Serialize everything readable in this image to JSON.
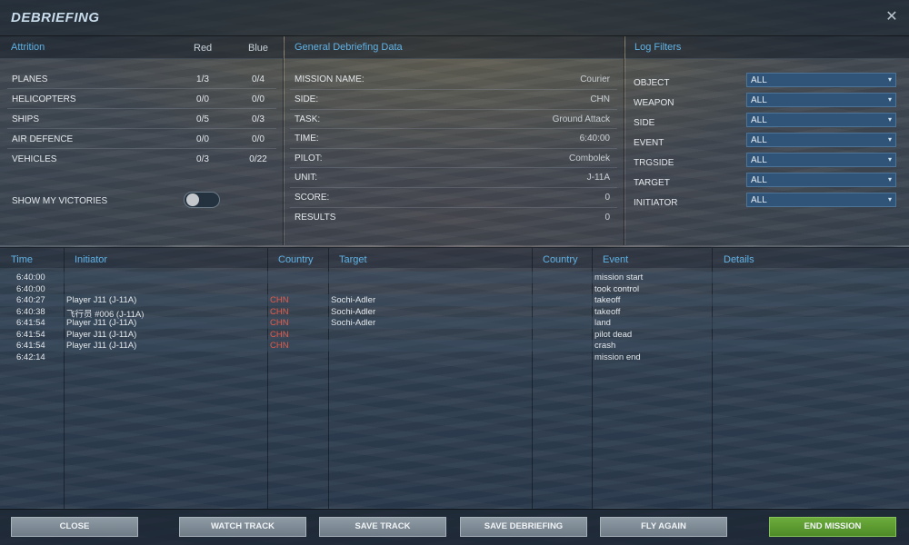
{
  "window": {
    "title": "DEBRIEFING"
  },
  "attrition": {
    "header": "Attrition",
    "col_red": "Red",
    "col_blue": "Blue",
    "rows": [
      {
        "label": "PLANES",
        "red": "1/3",
        "blue": "0/4"
      },
      {
        "label": "HELICOPTERS",
        "red": "0/0",
        "blue": "0/0"
      },
      {
        "label": "SHIPS",
        "red": "0/5",
        "blue": "0/3"
      },
      {
        "label": "AIR DEFENCE",
        "red": "0/0",
        "blue": "0/0"
      },
      {
        "label": "VEHICLES",
        "red": "0/3",
        "blue": "0/22"
      }
    ],
    "show_victories_label": "SHOW MY VICTORIES",
    "show_victories_on": false
  },
  "general": {
    "header": "General Debriefing Data",
    "rows": [
      {
        "label": "MISSION NAME:",
        "value": "Courier"
      },
      {
        "label": "SIDE:",
        "value": "CHN"
      },
      {
        "label": "TASK:",
        "value": "Ground Attack"
      },
      {
        "label": "TIME:",
        "value": "6:40:00"
      },
      {
        "label": "PILOT:",
        "value": "Combolek"
      },
      {
        "label": "UNIT:",
        "value": "J-11A"
      },
      {
        "label": "SCORE:",
        "value": "0"
      },
      {
        "label": "RESULTS",
        "value": "0"
      }
    ]
  },
  "log_filters": {
    "header": "Log Filters",
    "filters": [
      {
        "label": "OBJECT",
        "value": "ALL"
      },
      {
        "label": "WEAPON",
        "value": "ALL"
      },
      {
        "label": "SIDE",
        "value": "ALL"
      },
      {
        "label": "EVENT",
        "value": "ALL"
      },
      {
        "label": "TRGSIDE",
        "value": "ALL"
      },
      {
        "label": "TARGET",
        "value": "ALL"
      },
      {
        "label": "INITIATOR",
        "value": "ALL"
      }
    ]
  },
  "log": {
    "columns": {
      "time": "Time",
      "initiator": "Initiator",
      "country": "Country",
      "target": "Target",
      "target_country": "Country",
      "event": "Event",
      "details": "Details"
    },
    "rows": [
      {
        "time": "6:40:00",
        "initiator": "",
        "country": "",
        "target": "",
        "event": "mission start"
      },
      {
        "time": "6:40:00",
        "initiator": "",
        "country": "",
        "target": "",
        "event": "took control"
      },
      {
        "time": "6:40:27",
        "initiator": "Player J11 (J-11A)",
        "country": "CHN",
        "target": "Sochi-Adler",
        "event": "takeoff"
      },
      {
        "time": "6:40:38",
        "initiator": "飞行员 #006 (J-11A)",
        "country": "CHN",
        "target": "Sochi-Adler",
        "event": "takeoff"
      },
      {
        "time": "6:41:54",
        "initiator": "Player J11 (J-11A)",
        "country": "CHN",
        "target": "Sochi-Adler",
        "event": "land"
      },
      {
        "time": "6:41:54",
        "initiator": "Player J11 (J-11A)",
        "country": "CHN",
        "target": "",
        "event": "pilot dead"
      },
      {
        "time": "6:41:54",
        "initiator": "Player J11 (J-11A)",
        "country": "CHN",
        "target": "",
        "event": "crash"
      },
      {
        "time": "6:42:14",
        "initiator": "",
        "country": "",
        "target": "",
        "event": "mission end"
      }
    ]
  },
  "footer": {
    "close": "CLOSE",
    "watch_track": "WATCH TRACK",
    "save_track": "SAVE TRACK",
    "save_debriefing": "SAVE DEBRIEFING",
    "fly_again": "FLY AGAIN",
    "end_mission": "END MISSION"
  },
  "colors": {
    "accent": "#5fb2e6",
    "country_red": "#e85a4a",
    "end_mission_green": "#5a9a30"
  }
}
